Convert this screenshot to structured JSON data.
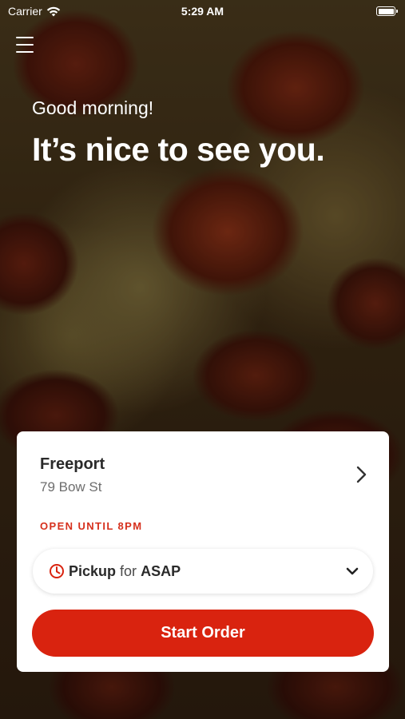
{
  "status_bar": {
    "carrier": "Carrier",
    "time": "5:29 AM"
  },
  "header": {
    "greeting": "Good morning!",
    "headline": "It’s nice to see you."
  },
  "store": {
    "name": "Freeport",
    "address": "79 Bow St",
    "hours_status": "OPEN UNTIL 8PM"
  },
  "order_mode": {
    "mode": "Pickup",
    "connector": "for",
    "time": "ASAP"
  },
  "actions": {
    "start_order_label": "Start Order"
  },
  "icons": {
    "menu": "hamburger-menu-icon",
    "wifi": "wifi-icon",
    "battery": "battery-icon",
    "location_chevron": "chevron-right-icon",
    "clock": "clock-icon",
    "dropdown": "chevron-down-icon"
  },
  "colors": {
    "accent": "#d9230f",
    "status_red": "#d6301d",
    "text_dark": "#2a2a2a",
    "text_muted": "#6e6e6e"
  }
}
